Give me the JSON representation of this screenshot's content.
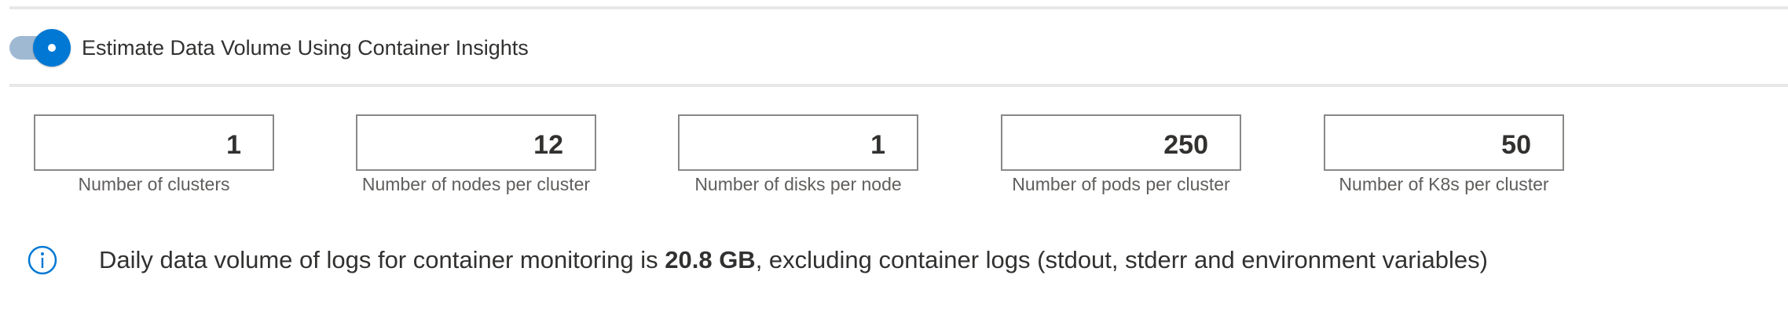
{
  "toggle": {
    "label": "Estimate Data Volume Using Container Insights",
    "state": "on",
    "accent_color": "#0078d4"
  },
  "fields": [
    {
      "label": "Number of clusters",
      "value": "1"
    },
    {
      "label": "Number of nodes per cluster",
      "value": "12"
    },
    {
      "label": "Number of disks per node",
      "value": "1"
    },
    {
      "label": "Number of pods per cluster",
      "value": "250"
    },
    {
      "label": "Number of K8s per cluster",
      "value": "50"
    }
  ],
  "info": {
    "icon": "info-icon",
    "text_before": "Daily data volume of logs for container monitoring is ",
    "volume": "20.8 GB",
    "text_after": ", excluding container logs (stdout, stderr and environment variables)"
  }
}
